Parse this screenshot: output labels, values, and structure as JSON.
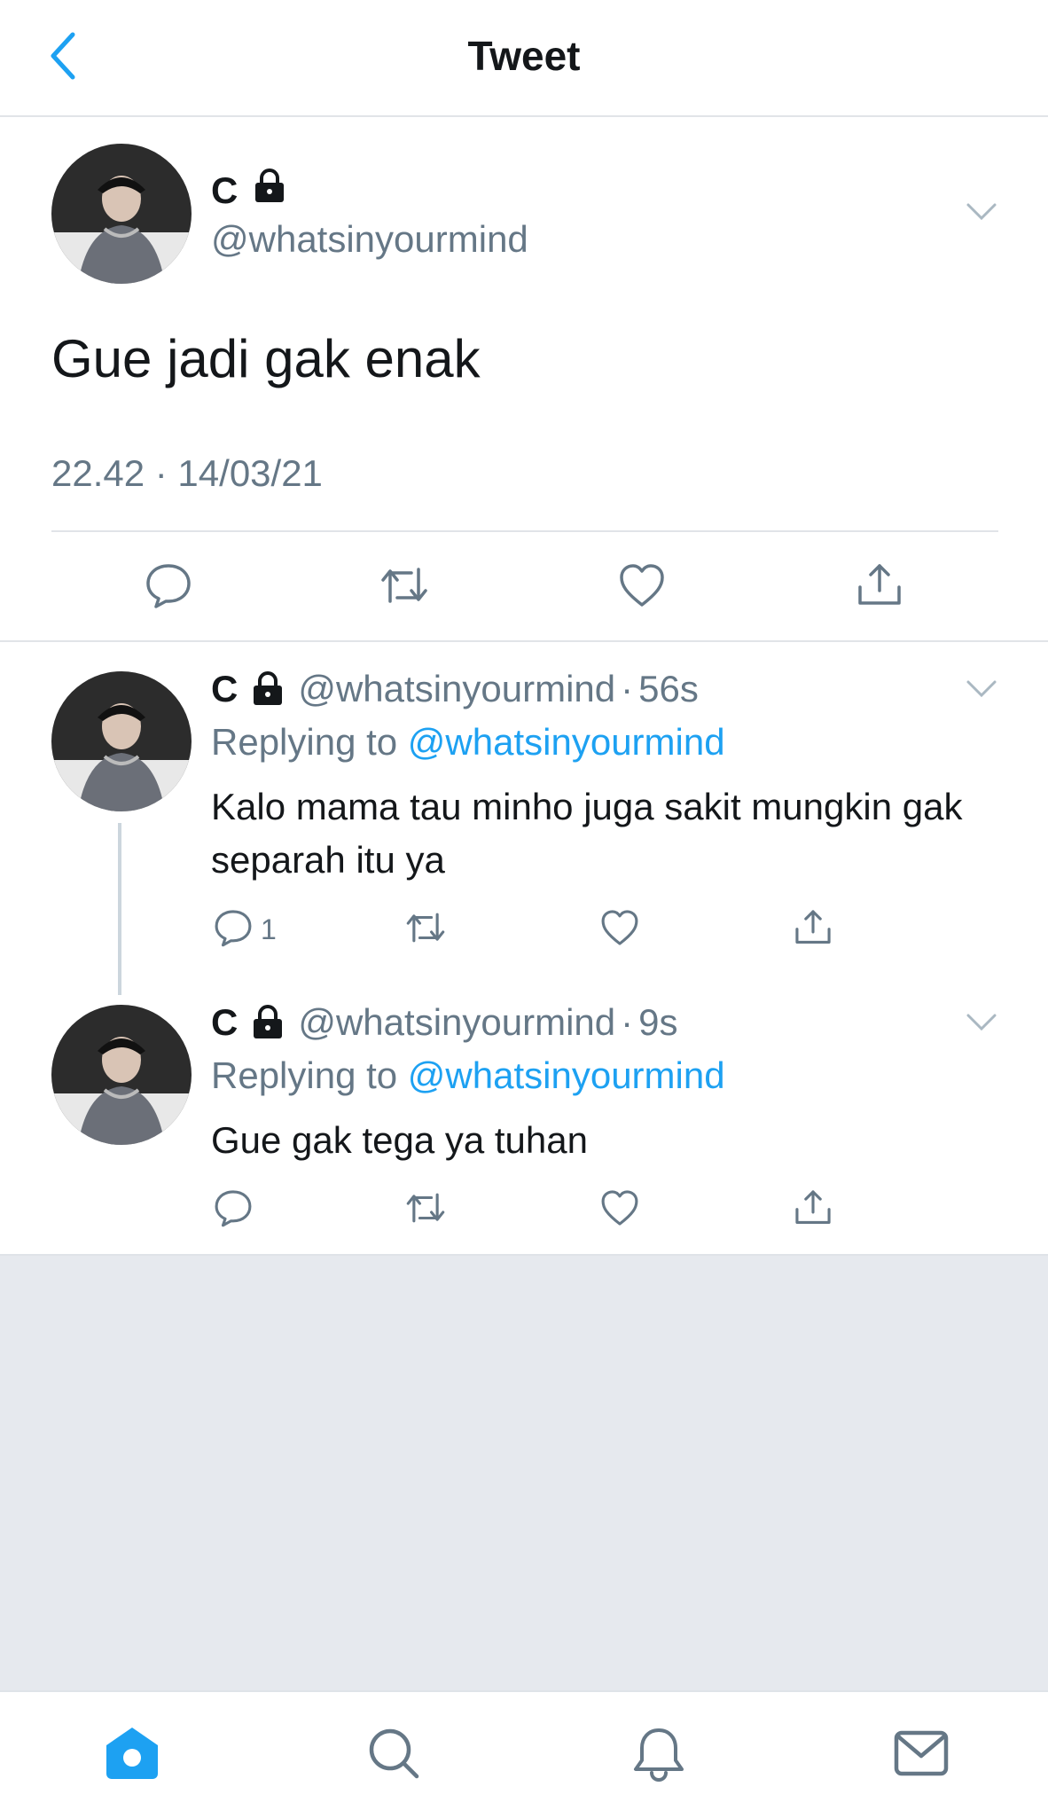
{
  "header": {
    "title": "Tweet",
    "back_icon": "chevron-left-icon"
  },
  "colors": {
    "accent": "#1da1f2",
    "secondary_text": "#657786",
    "separator": "#e1e4e8",
    "background_fill": "#e6e9ee"
  },
  "main_tweet": {
    "name": "C",
    "handle": "@whatsinyourmind",
    "text": "Gue jadi gak enak",
    "timestamp": "22.42 · 14/03/21",
    "actions": [
      "reply-icon",
      "retweet-icon",
      "like-icon",
      "share-icon"
    ]
  },
  "replies": [
    {
      "name": "C",
      "handle": "@whatsinyourmind",
      "separator": "·",
      "time": "56s",
      "replying_label": "Replying to",
      "replying_to": "@whatsinyourmind",
      "text": "Kalo mama tau minho juga sakit mungkin gak separah itu ya",
      "reply_count": "1"
    },
    {
      "name": "C",
      "handle": "@whatsinyourmind",
      "separator": "·",
      "time": "9s",
      "replying_label": "Replying to",
      "replying_to": "@whatsinyourmind",
      "text": "Gue gak tega ya tuhan",
      "reply_count": ""
    }
  ],
  "tabbar": {
    "items": [
      "home-icon",
      "search-icon",
      "notifications-icon",
      "messages-icon"
    ],
    "active": "home-icon"
  }
}
